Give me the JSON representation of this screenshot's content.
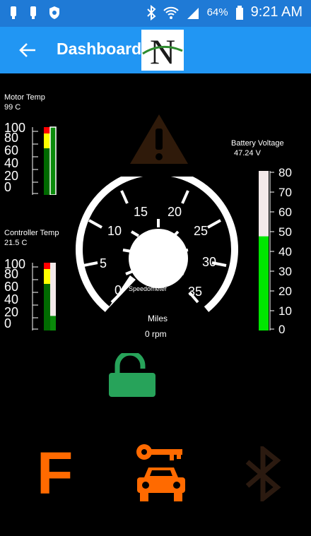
{
  "status_bar": {
    "battery_percent": "64%",
    "time": "9:21 AM",
    "icons": [
      "notification-icon",
      "notification-icon",
      "shield-icon",
      "bluetooth-icon",
      "wifi-icon",
      "signal-icon",
      "battery-icon"
    ]
  },
  "app_bar": {
    "title": "Dashboard",
    "back_icon": "arrow-left-icon",
    "logo_letter": "N"
  },
  "motor_temp": {
    "label": "Motor Temp",
    "value": "99 C",
    "ticks": [
      "100",
      "80",
      "60",
      "40",
      "20",
      "0"
    ],
    "level_fraction": 0.99
  },
  "controller_temp": {
    "label": "Controller Temp",
    "value": "21.5 C",
    "ticks": [
      "100",
      "80",
      "60",
      "40",
      "20",
      "0"
    ],
    "level_fraction": 0.215
  },
  "battery": {
    "label": "Battery Voltage",
    "value": "47.24 V",
    "ticks": [
      "80",
      "70",
      "60",
      "50",
      "40",
      "30",
      "20",
      "10",
      "0"
    ],
    "level_fraction": 0.59
  },
  "speedometer": {
    "label": "Speedometer",
    "ticks": [
      "0",
      "5",
      "10",
      "15",
      "20",
      "25",
      "30",
      "35"
    ],
    "units_label": "Miles",
    "rpm": "0 rpm"
  },
  "indicators": {
    "warning_icon": "warning-icon",
    "lock_icon": "unlocked-icon",
    "gear_letter": "F",
    "car_key_icon": "car-key-icon",
    "bluetooth_icon": "bluetooth-icon"
  },
  "colors": {
    "status_bar": "#1f7ad6",
    "app_bar": "#2196f3",
    "gauge_green": "#00e600",
    "gauge_yellow": "#ffff00",
    "gauge_red": "#ff0000",
    "lock_green": "#27a35a",
    "orange": "#ff6a00",
    "warning_dim": "#2f1a0a"
  }
}
